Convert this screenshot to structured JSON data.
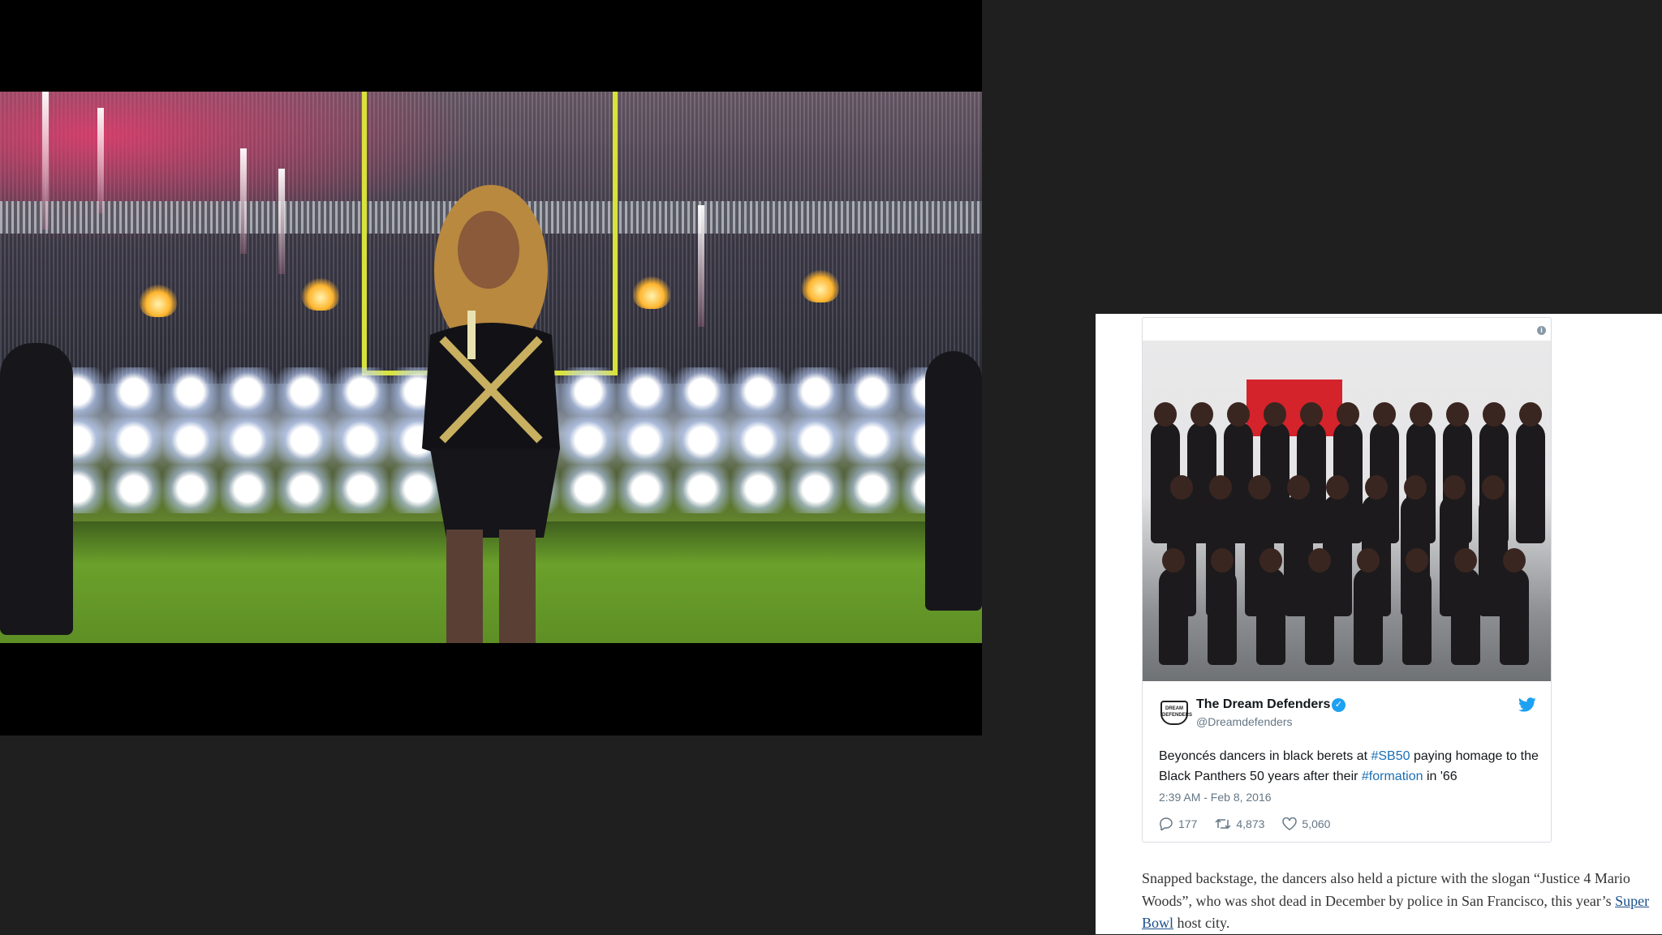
{
  "video": {
    "description_icon": "video-frame"
  },
  "tweet": {
    "author_name": "The Dream Defenders",
    "author_handle": "@Dreamdefenders",
    "avatar_text": "DREAM DEFENDERS",
    "text_part1": "Beyoncés dancers in black berets at ",
    "hashtag1": "#SB50",
    "text_part2": " paying homage to the Black Panthers 50 years after their ",
    "hashtag2": "#formation",
    "text_part3": " in '66",
    "timestamp": "2:39 AM - Feb 8, 2016",
    "replies": "177",
    "retweets": "4,873",
    "likes": "5,060",
    "info_icon": "i"
  },
  "caption": {
    "part1": "Snapped backstage, the dancers also held a picture with the slogan “Justice 4 Mario Woods”, who was shot dead in December by police in San Francisco, this year’s ",
    "link": "Super Bowl",
    "part2": " host city."
  },
  "colors": {
    "background": "#1f1f1f",
    "twitter_blue": "#1da1f2",
    "link": "#1a4f8b",
    "hashtag": "#1b6fb5"
  }
}
